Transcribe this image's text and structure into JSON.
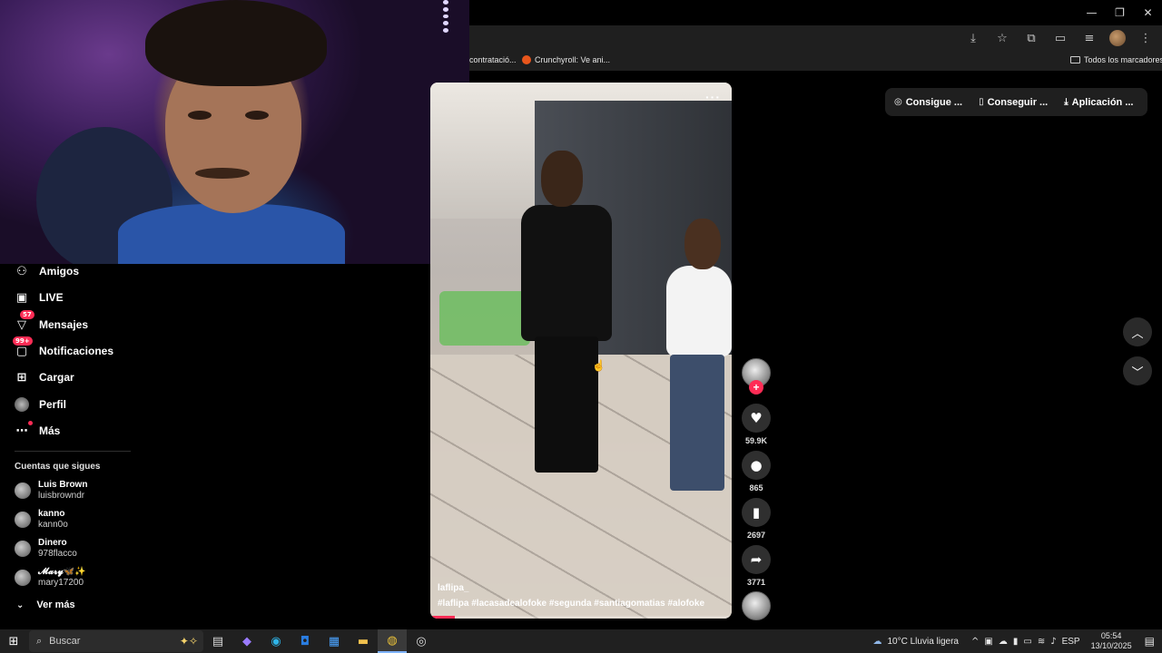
{
  "window_controls": {
    "minimize": "—",
    "restore": "❐",
    "close": "✕"
  },
  "bookmarks": {
    "item1": "contratació...",
    "item2": "Crunchyroll: Ve ani...",
    "folder": "Todos los marcadores"
  },
  "sidebar": {
    "items": [
      {
        "label": "Amigos",
        "icon": "friends-icon"
      },
      {
        "label": "LIVE",
        "icon": "live-icon"
      },
      {
        "label": "Mensajes",
        "icon": "messages-icon",
        "badge": "57"
      },
      {
        "label": "Notificaciones",
        "icon": "notifications-icon",
        "badge": "99+"
      },
      {
        "label": "Cargar",
        "icon": "upload-icon"
      },
      {
        "label": "Perfil",
        "icon": "profile-icon"
      },
      {
        "label": "Más",
        "icon": "more-icon"
      }
    ],
    "following_header": "Cuentas que sigues",
    "accounts": [
      {
        "name": "Luis Brown",
        "user": "luisbrowndr"
      },
      {
        "name": "kanno",
        "user": "kann0o"
      },
      {
        "name": "Dinero",
        "user": "978flacco"
      },
      {
        "name": "𝓜𝓪𝓻𝔂🦋✨",
        "user": "mary17200"
      }
    ],
    "see_more": "Ver más"
  },
  "video": {
    "author": "laflipa_",
    "hashtags": "#laflipa #lacasadealofoke #segunda #santiagomatias #alofoke",
    "progress": 0.08
  },
  "actions": {
    "likes": "59.9K",
    "comments": "865",
    "saves": "2697",
    "shares": "3771"
  },
  "top_right": {
    "coins": "Consigue ...",
    "get_app": "Conseguir ...",
    "app": "Aplicación ..."
  },
  "taskbar": {
    "search_placeholder": "Buscar",
    "weather": "10°C  Lluvia ligera",
    "lang": "ESP",
    "time": "05:54",
    "date": "13/10/2025"
  },
  "colors": {
    "accent": "#fe2c55",
    "background": "#000000"
  }
}
